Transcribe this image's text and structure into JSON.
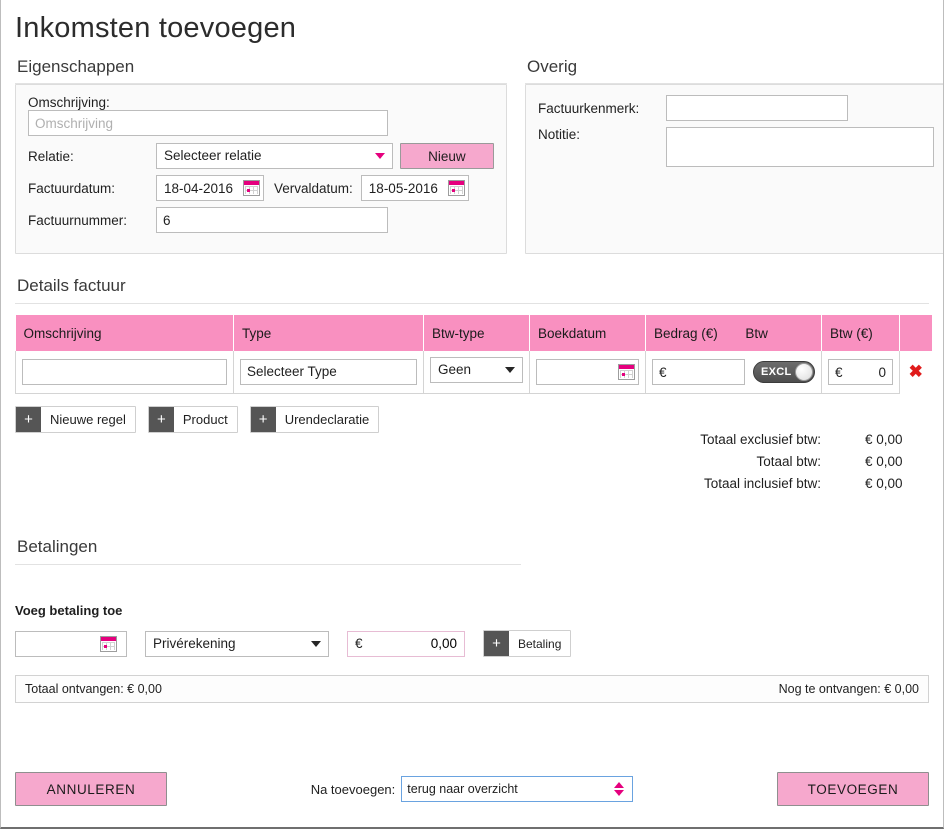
{
  "page": {
    "title": "Inkomsten toevoegen"
  },
  "eigenschappen": {
    "heading": "Eigenschappen",
    "omschrijving_label": "Omschrijving:",
    "omschrijving_placeholder": "Omschrijving",
    "omschrijving_value": "",
    "relatie_label": "Relatie:",
    "relatie_value": "Selecteer relatie",
    "nieuw_button": "Nieuw",
    "factuurdatum_label": "Factuurdatum:",
    "factuurdatum_value": "18-04-2016",
    "vervaldatum_label": "Vervaldatum:",
    "vervaldatum_value": "18-05-2016",
    "factuurnummer_label": "Factuurnummer:",
    "factuurnummer_value": "6"
  },
  "overig": {
    "heading": "Overig",
    "factuurkenmerk_label": "Factuurkenmerk:",
    "factuurkenmerk_value": "",
    "notitie_label": "Notitie:",
    "notitie_value": ""
  },
  "details": {
    "heading": "Details factuur",
    "columns": [
      "Omschrijving",
      "Type",
      "Btw-type",
      "Boekdatum",
      "Bedrag (€)",
      "Btw",
      "Btw (€)",
      ""
    ],
    "row": {
      "omschrijving": "",
      "type": "Selecteer Type",
      "btw_type": "Geen",
      "boekdatum": "",
      "bedrag_symbol": "€",
      "bedrag_value": "",
      "btw_toggle_label": "EXCL",
      "btw_symbol": "€",
      "btw_value": "0",
      "delete_icon": "✖"
    },
    "add_buttons": [
      {
        "plus": "+",
        "label": "Nieuwe regel"
      },
      {
        "plus": "+",
        "label": "Product"
      },
      {
        "plus": "+",
        "label": "Urendeclaratie"
      }
    ],
    "totals": [
      {
        "label": "Totaal exclusief btw:",
        "value": "€ 0,00"
      },
      {
        "label": "Totaal btw:",
        "value": "€ 0,00"
      },
      {
        "label": "Totaal inclusief btw:",
        "value": "€ 0,00"
      }
    ]
  },
  "betalingen": {
    "heading": "Betalingen",
    "voeg_label": "Voeg betaling toe",
    "date_value": "",
    "account_value": "Privérekening",
    "amount_symbol": "€",
    "amount_value": "0,00",
    "add_plus": "+",
    "add_label": "Betaling",
    "totaal_ontvangen": "Totaal ontvangen: € 0,00",
    "nog_te_ontvangen": "Nog te ontvangen: € 0,00"
  },
  "footer": {
    "cancel_label": "ANNULEREN",
    "na_toevoegen_label": "Na toevoegen:",
    "na_toevoegen_value": "terug naar overzicht",
    "submit_label": "TOEVOEGEN"
  },
  "colors": {
    "accent_pink": "#e5007e",
    "button_pink": "#f6a8cd",
    "table_header_pink": "#f990c0",
    "delete_red": "#e01b1b"
  }
}
